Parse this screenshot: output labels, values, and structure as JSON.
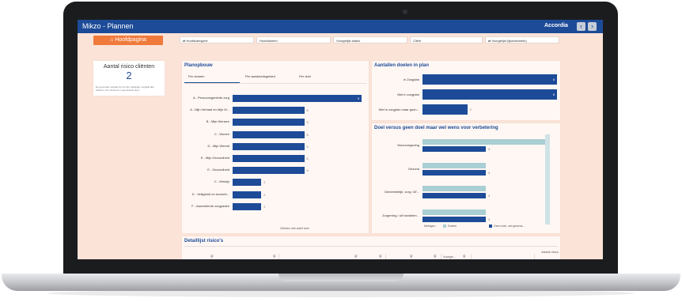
{
  "app": {
    "title": "Mikzo - Plannen",
    "org": "Accordia",
    "nav_prev": "‹",
    "nav_next": "›"
  },
  "home_button": "⌂ Hoofdpagina",
  "filters": [
    "⇄ Hoofdcategorie",
    "Hoofddoelen",
    "Voorgelijst status",
    "Cliënt",
    "⇄ Voorgelijst (tijdens/week)"
  ],
  "kpi": {
    "label": "Aantal risico cliënten",
    "value": "2",
    "note": "De gevonden situatie zijn (of als volledige) mogelijk alle cliënten met minstens 1 openstaand doel."
  },
  "planopbouw": {
    "title": "Planopbouw",
    "tabs": [
      "Per domein",
      "Per aandachtsgebied",
      "Per doel"
    ],
    "rows": [
      {
        "label": "A - Persoonsgerichte zorg",
        "value": 9,
        "value_label": "9"
      },
      {
        "label": "A - Mijn Verhaal en Mijn M...",
        "value": 5,
        "value_label": "5"
      },
      {
        "label": "B - Mijn Wensen",
        "value": 5,
        "value_label": "5"
      },
      {
        "label": "C - Wonen",
        "value": 5,
        "value_label": "5"
      },
      {
        "label": "D - Mijn Wereld",
        "value": 5,
        "value_label": "5"
      },
      {
        "label": "E - Mijn Gezondheid",
        "value": 5,
        "value_label": "5"
      },
      {
        "label": "E - Gezondheid",
        "value": 5,
        "value_label": "5"
      },
      {
        "label": "C - Welzijn",
        "value": 2,
        "value_label": "2"
      },
      {
        "label": "D - Veiligheid en toezicht...",
        "value": 2,
        "value_label": "2"
      },
      {
        "label": "F - Aanvullende zorgpaden",
        "value": 2,
        "value_label": "2"
      }
    ],
    "footer": "Cliënten met actief doel"
  },
  "doelen": {
    "title": "Aantallen doelen in plan",
    "rows": [
      {
        "label": "In Zorgplan",
        "value": 6,
        "value_label": "6"
      },
      {
        "label": "Niet in zorgplan",
        "value": 6,
        "value_label": "6"
      },
      {
        "label": "Niet in zorgplan maar geen...",
        "value": 2,
        "value_label": "2"
      }
    ]
  },
  "versus": {
    "title": "Doel versus geen doel maar wel wens voor verbetering",
    "rows": [
      {
        "label": "Woonomgeving",
        "a": 6,
        "b": 3,
        "b_label": "3"
      },
      {
        "label": "Gezond",
        "a": 3,
        "b": 3,
        "b_label": "3"
      },
      {
        "label": "Gemeentelijk: zorg / AT...",
        "a": 3,
        "b": 3,
        "b_label": "3"
      },
      {
        "label": "Zorgerring / uit handelen...",
        "a": 3,
        "b": 3,
        "b_label": "3"
      }
    ],
    "legend_title": "Metingen",
    "legend": [
      "Doelen",
      "Geen doel, wel gewens..."
    ]
  },
  "detail": {
    "title": "Detaillijst risico's",
    "cols": [
      "",
      "",
      "",
      "",
      "Voorge...",
      "",
      "Aantal risico"
    ]
  },
  "colors": {
    "primary": "#1d4b98",
    "accent": "#f07a3c",
    "light_bar": "#a9ced3",
    "bg": "#fbe3d8"
  }
}
